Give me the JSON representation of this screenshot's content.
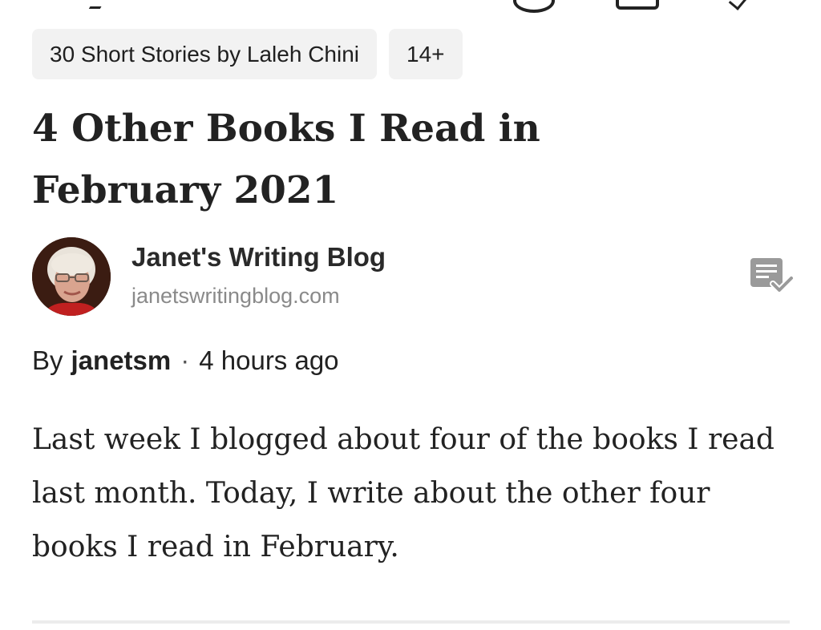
{
  "tags": [
    {
      "label": "30 Short Stories by Laleh Chini"
    },
    {
      "label": "14+"
    }
  ],
  "post": {
    "title": "4 Other Books I Read in February 2021",
    "byline_prefix": "By",
    "author": "janetsm",
    "separator": "·",
    "time_ago": "4 hours ago",
    "excerpt": "Last week I blogged about four of the books I read last month. Today, I write about the other four books I read in February."
  },
  "publication": {
    "name": "Janet's Writing Blog",
    "domain": "janetswritingblog.com",
    "avatar_icon": "author-avatar",
    "action_icon": "subscribed-check-icon"
  },
  "colors": {
    "tag_bg": "#f2f2f2",
    "text": "#222222",
    "muted": "#8a8a8a",
    "icon": "#9a9a9a"
  }
}
